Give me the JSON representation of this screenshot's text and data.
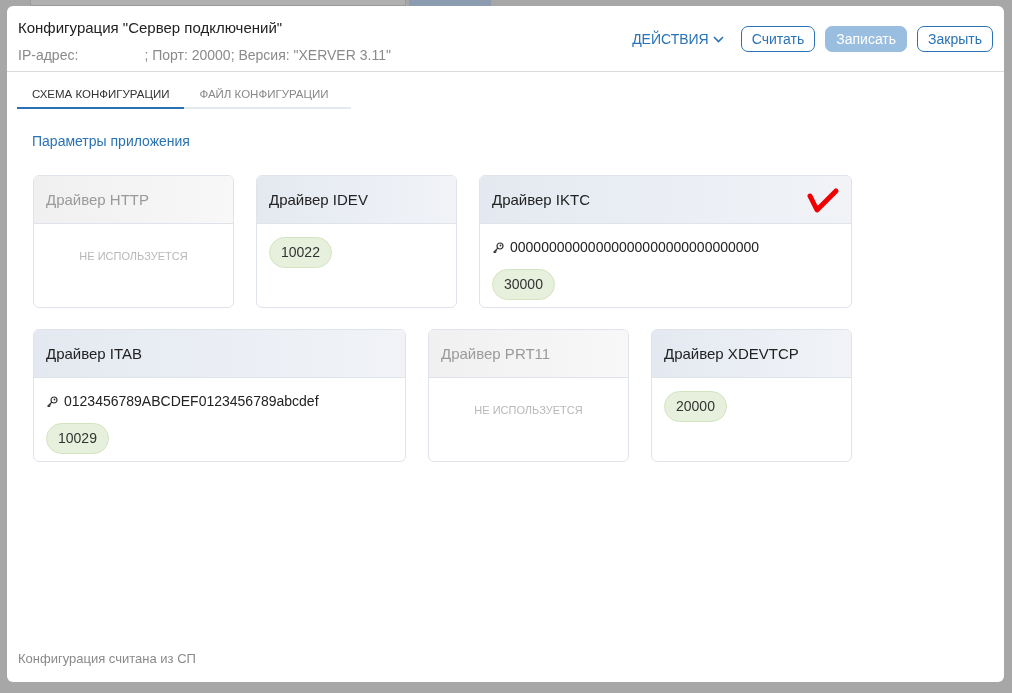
{
  "window": {
    "title": "Конфигурация \"Сервер подключений\"",
    "subtitle": "IP-адрес:                 ; Порт: 20000; Версия: \"XERVER 3.11\""
  },
  "actions": {
    "menu": "ДЕЙСТВИЯ",
    "buttons": [
      {
        "label": "Считать",
        "disabled": false
      },
      {
        "label": "Записать",
        "disabled": true
      },
      {
        "label": "Закрыть",
        "disabled": false
      }
    ]
  },
  "tabs": [
    {
      "label": "СХЕМА КОНФИГУРАЦИИ",
      "selected": true
    },
    {
      "label": "ФАЙЛ КОНФИГУРАЦИИ",
      "selected": false
    }
  ],
  "section_link": "Параметры приложения",
  "drivers": [
    {
      "name": "Драйвер HTTP",
      "used": false,
      "status": "НЕ ИСПОЛЬЗУЕТСЯ",
      "checked": false
    },
    {
      "name": "Драйвер IDEV",
      "used": true,
      "port": "10022",
      "checked": false
    },
    {
      "name": "Драйвер IKTC",
      "used": true,
      "key": "00000000000000000000000000000000",
      "port": "30000",
      "checked": true
    },
    {
      "name": "Драйвер ITAB",
      "used": true,
      "key": "0123456789ABCDEF0123456789abcdef",
      "port": "10029",
      "checked": false
    },
    {
      "name": "Драйвер PRT11",
      "used": false,
      "status": "НЕ ИСПОЛЬЗУЕТСЯ",
      "checked": false
    },
    {
      "name": "Драйвер XDEVTCP",
      "used": true,
      "port": "20000",
      "checked": false
    }
  ],
  "status_bar": "Конфигурация считана из СП"
}
